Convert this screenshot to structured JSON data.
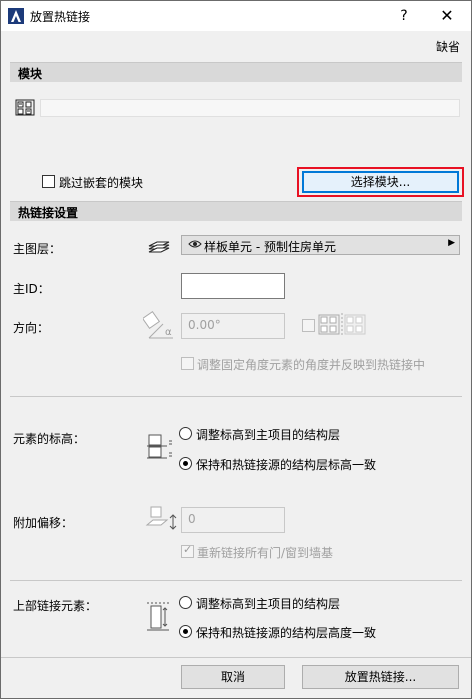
{
  "window": {
    "title": "放置热链接",
    "help_label": "?",
    "close_label": "✕"
  },
  "default_link": "缺省",
  "module_section": {
    "header": "模块",
    "skip_nested_label": "跳过嵌套的模块",
    "select_module_button": "选择模块..."
  },
  "hotlink_settings": {
    "header": "热链接设置",
    "master_layer_label": "主图层：",
    "master_layer_value": "样板单元 - 预制住房单元",
    "master_id_label": "主ID：",
    "master_id_value": "",
    "orientation_label": "方向：",
    "angle_value": "0.00°",
    "adjust_angle_label": "调整固定角度元素的角度并反映到热链接中"
  },
  "elevation": {
    "label": "元素的标高：",
    "option_adjust": "调整标高到主项目的结构层",
    "option_keep": "保持和热链接源的结构层标高一致",
    "selected": "option_keep"
  },
  "offset": {
    "label": "附加偏移：",
    "value": "0",
    "relink_label": "重新链接所有门/窗到墙基"
  },
  "top_linked": {
    "label": "上部链接元素：",
    "option_adjust": "调整标高到主项目的结构层",
    "option_keep": "保持和热链接源的结构层高度一致",
    "selected": "option_keep"
  },
  "footer": {
    "cancel_button": "取消",
    "place_button": "放置热链接..."
  },
  "colors": {
    "focus_ring": "#e81123",
    "primary_border": "#0078d7",
    "section_bg": "#d9d9d9"
  }
}
